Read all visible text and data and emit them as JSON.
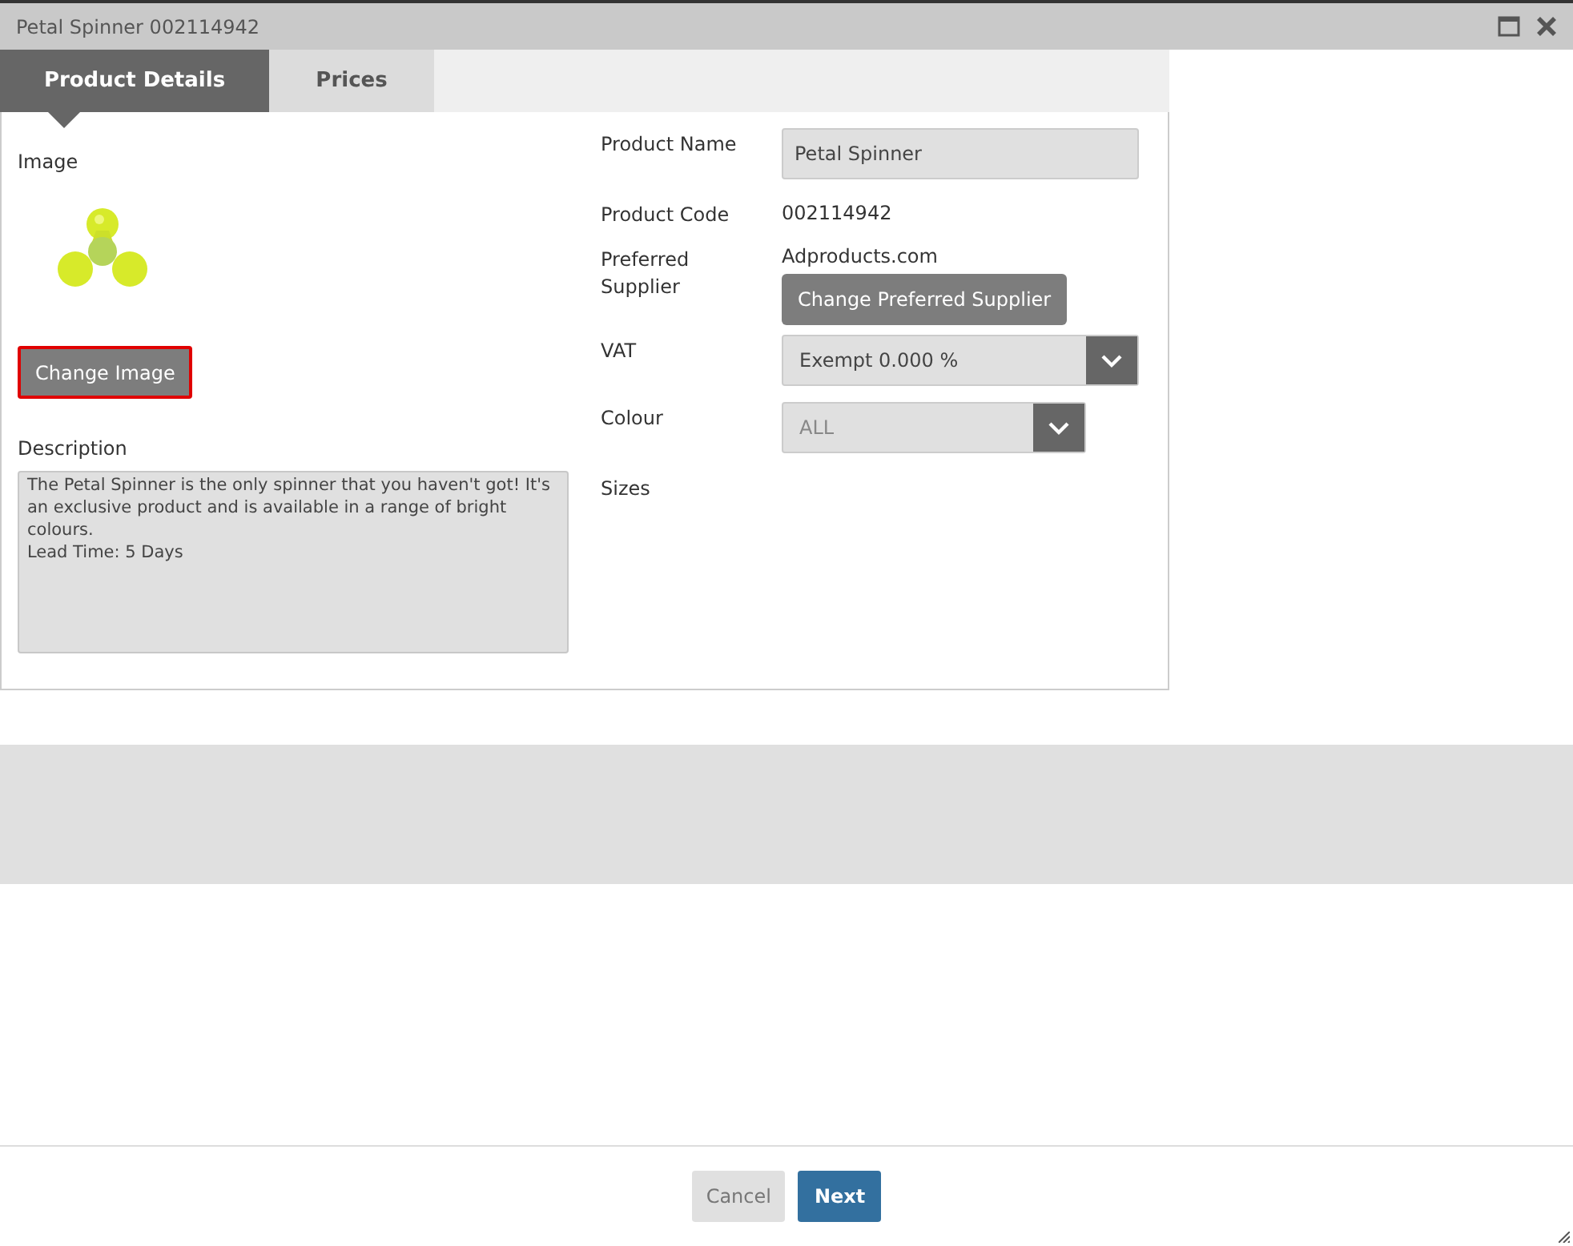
{
  "window": {
    "title": "Petal Spinner 002114942"
  },
  "tabs": [
    {
      "label": "Product Details",
      "selected": true
    },
    {
      "label": "Prices",
      "selected": false
    }
  ],
  "image_section": {
    "label": "Image",
    "change_button": {
      "label": "Change Image",
      "focused": true
    }
  },
  "description": {
    "label": "Description",
    "value": "The Petal Spinner is the only spinner that you haven't got! It's an exclusive product and is available in a range of bright colours.\nLead Time: 5 Days"
  },
  "fields": [
    {
      "kind": "input",
      "label": "Product Name",
      "value": "Petal Spinner"
    },
    {
      "kind": "text",
      "label": "Product Code",
      "value": "002114942"
    },
    {
      "kind": "supplier",
      "label": "Preferred Supplier",
      "value": "Adproducts.com",
      "button": "Change Preferred Supplier"
    },
    {
      "kind": "select",
      "label": "VAT",
      "value": "Exempt 0.000 %",
      "disabled": false
    },
    {
      "kind": "select",
      "label": "Colour",
      "value": "ALL",
      "disabled": true
    },
    {
      "kind": "empty",
      "label": "Sizes"
    }
  ],
  "buttons": [
    {
      "label": "Cancel",
      "primary": false
    },
    {
      "label": "Next",
      "primary": true
    }
  ]
}
